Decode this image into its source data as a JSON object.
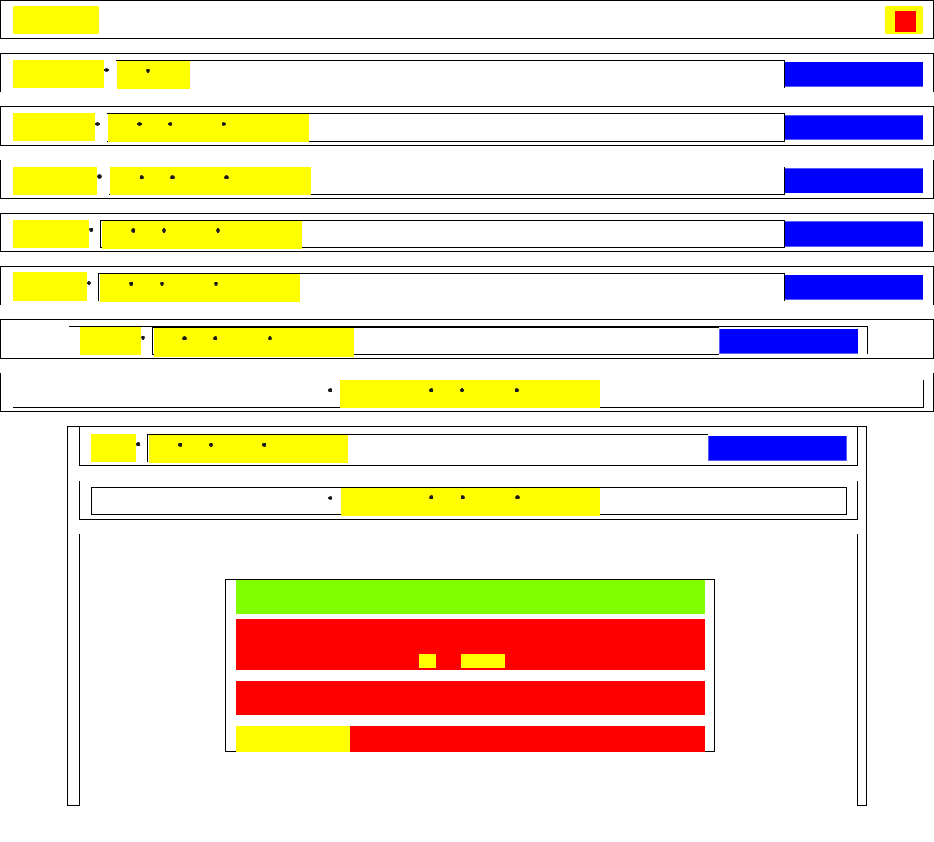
{
  "header": {
    "logo_label": "",
    "menu_label": ""
  },
  "rows": [
    {
      "label": "",
      "value": "",
      "action": ""
    },
    {
      "label": "",
      "value": "",
      "action": ""
    },
    {
      "label": "",
      "value": "",
      "action": ""
    },
    {
      "label": "",
      "value": "",
      "action": ""
    },
    {
      "label": "",
      "value": "",
      "action": ""
    },
    {
      "label": "",
      "value": "",
      "action": ""
    },
    {
      "value": ""
    }
  ],
  "panel": {
    "row": {
      "label": "",
      "value": "",
      "action": ""
    },
    "center_row": {
      "value": ""
    },
    "card": {
      "title": "",
      "body_a": "",
      "body_b": "",
      "footer": "",
      "footer_value": ""
    }
  },
  "colors": {
    "placeholder": "#ffff00",
    "primary_button": "#0000ff",
    "alert": "#ff0000",
    "success": "#7fff00"
  }
}
